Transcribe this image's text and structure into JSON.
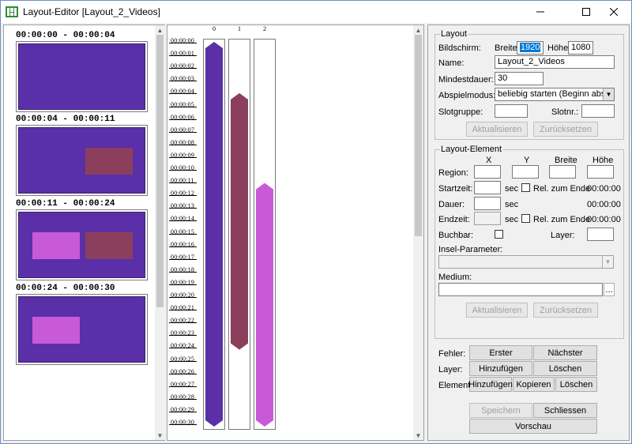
{
  "window": {
    "title": "Layout-Editor [Layout_2_Videos]",
    "min_icon": "minimize-icon",
    "max_icon": "maximize-icon",
    "close_icon": "close-icon"
  },
  "colors": {
    "background": "#5a2fa8",
    "region_dark": "#8b3f5c",
    "region_light": "#c85ad8",
    "bar_0": "#5a2fa8",
    "bar_1": "#8b3f5c",
    "bar_2": "#c85ad8"
  },
  "preview": {
    "slots": [
      {
        "label": "00:00:00 - 00:00:04"
      },
      {
        "label": "00:00:04 - 00:00:11"
      },
      {
        "label": "00:00:11 - 00:00:24"
      },
      {
        "label": "00:00:24 - 00:00:30"
      }
    ]
  },
  "timeline": {
    "lanes": [
      "0",
      "1",
      "2"
    ],
    "ticks": [
      "00:00:00",
      "00:00:01",
      "00:00:02",
      "00:00:03",
      "00:00:04",
      "00:00:05",
      "00:00:06",
      "00:00:07",
      "00:00:08",
      "00:00:09",
      "00:00:10",
      "00:00:11",
      "00:00:12",
      "00:00:13",
      "00:00:14",
      "00:00:15",
      "00:00:16",
      "00:00:17",
      "00:00:18",
      "00:00:19",
      "00:00:20",
      "00:00:21",
      "00:00:22",
      "00:00:23",
      "00:00:24",
      "00:00:25",
      "00:00:26",
      "00:00:27",
      "00:00:28",
      "00:00:29",
      "00:00:30"
    ],
    "bars": [
      {
        "lane": 0,
        "start": 0,
        "end": 30
      },
      {
        "lane": 1,
        "start": 4,
        "end": 24
      },
      {
        "lane": 2,
        "start": 11,
        "end": 30
      }
    ]
  },
  "layout": {
    "group_title": "Layout",
    "bildschirm_label": "Bildschirm:",
    "breite_label": "Breite:",
    "breite_value": "1920",
    "hoehe_label": "Höhe:",
    "hoehe_value": "1080",
    "name_label": "Name:",
    "name_value": "Layout_2_Videos",
    "mindestdauer_label": "Mindestdauer:",
    "mindestdauer_value": "30",
    "abspielmodus_label": "Abspielmodus:",
    "abspielmodus_value": "beliebig starten (Beginn abschneiden)",
    "slotgruppe_label": "Slotgruppe:",
    "slotnr_label": "Slotnr.:",
    "aktualisieren": "Aktualisieren",
    "zuruecksetzen": "Zurücksetzen"
  },
  "element": {
    "group_title": "Layout-Element",
    "col_x": "X",
    "col_y": "Y",
    "col_breite": "Breite",
    "col_hoehe": "Höhe",
    "region_label": "Region:",
    "startzeit_label": "Startzeit:",
    "dauer_label": "Dauer:",
    "endzeit_label": "Endzeit:",
    "sec": "sec",
    "rel_label": "Rel. zum Ende",
    "startzeit_time": "00:00:00",
    "dauer_time": "00:00:00",
    "endzeit_time": "00:00:00",
    "buchbar_label": "Buchbar:",
    "layer_label": "Layer:",
    "insel_label": "Insel-Parameter:",
    "medium_label": "Medium:",
    "browse": "...",
    "aktualisieren": "Aktualisieren",
    "zuruecksetzen": "Zurücksetzen"
  },
  "actions": {
    "fehler_label": "Fehler:",
    "erster": "Erster",
    "naechster": "Nächster",
    "layer_label": "Layer:",
    "layer_hinzufuegen": "Hinzufügen",
    "layer_loeschen": "Löschen",
    "element_label": "Element:",
    "element_hinzufuegen": "Hinzufügen",
    "kopieren": "Kopieren",
    "element_loeschen": "Löschen",
    "speichern": "Speichern",
    "schliessen": "Schliessen",
    "vorschau": "Vorschau"
  }
}
